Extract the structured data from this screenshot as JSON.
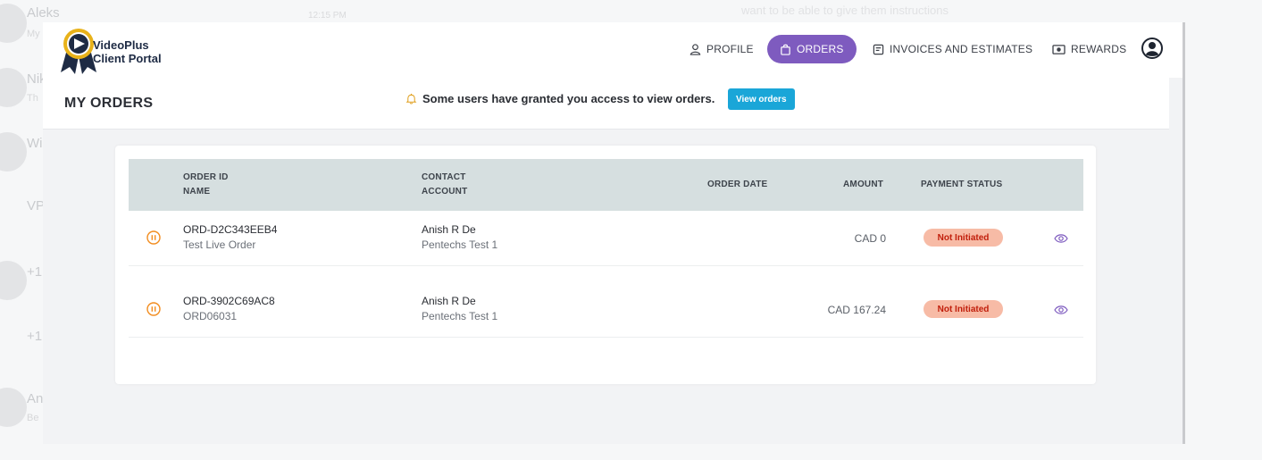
{
  "background": {
    "chat_items": [
      {
        "name": "Aleks",
        "sub": "My",
        "time": "12:15 PM"
      },
      {
        "name": "Nik",
        "sub": "Th"
      },
      {
        "name": "Wi",
        "sub": ""
      },
      {
        "name": "VP",
        "sub": ""
      },
      {
        "name": "+1",
        "sub": ""
      },
      {
        "name": "+1",
        "sub": ""
      },
      {
        "name": "An",
        "sub": "Be"
      }
    ],
    "top_message": "want to be able to give them instructions"
  },
  "logo": {
    "line1": "VideoPlus",
    "line2": "Client Portal"
  },
  "nav": {
    "profile": "PROFILE",
    "orders": "ORDERS",
    "invoices": "INVOICES AND ESTIMATES",
    "rewards": "REWARDS"
  },
  "page": {
    "title": "MY ORDERS",
    "notice": "Some users have granted you access to view orders.",
    "view_orders_button": "View orders"
  },
  "table": {
    "headers": {
      "order_id": "ORDER ID",
      "name": "NAME",
      "contact": "CONTACT",
      "account": "ACCOUNT",
      "order_date": "ORDER DATE",
      "amount": "AMOUNT",
      "payment_status": "PAYMENT STATUS"
    },
    "rows": [
      {
        "order_id": "ORD-D2C343EEB4",
        "name": "Test Live Order",
        "contact": "Anish R De",
        "account": "Pentechs Test 1",
        "order_date": "",
        "amount": "CAD 0",
        "payment_status": "Not Initiated"
      },
      {
        "order_id": "ORD-3902C69AC8",
        "name": "ORD06031",
        "contact": "Anish R De",
        "account": "Pentechs Test 1",
        "order_date": "",
        "amount": "CAD 167.24",
        "payment_status": "Not Initiated"
      }
    ]
  },
  "colors": {
    "accent": "#7e5bbf",
    "button": "#1aa6d8",
    "status_badge_bg": "#f7bba6",
    "status_badge_text": "#c11e0b",
    "pause_icon": "#f28c1e"
  }
}
